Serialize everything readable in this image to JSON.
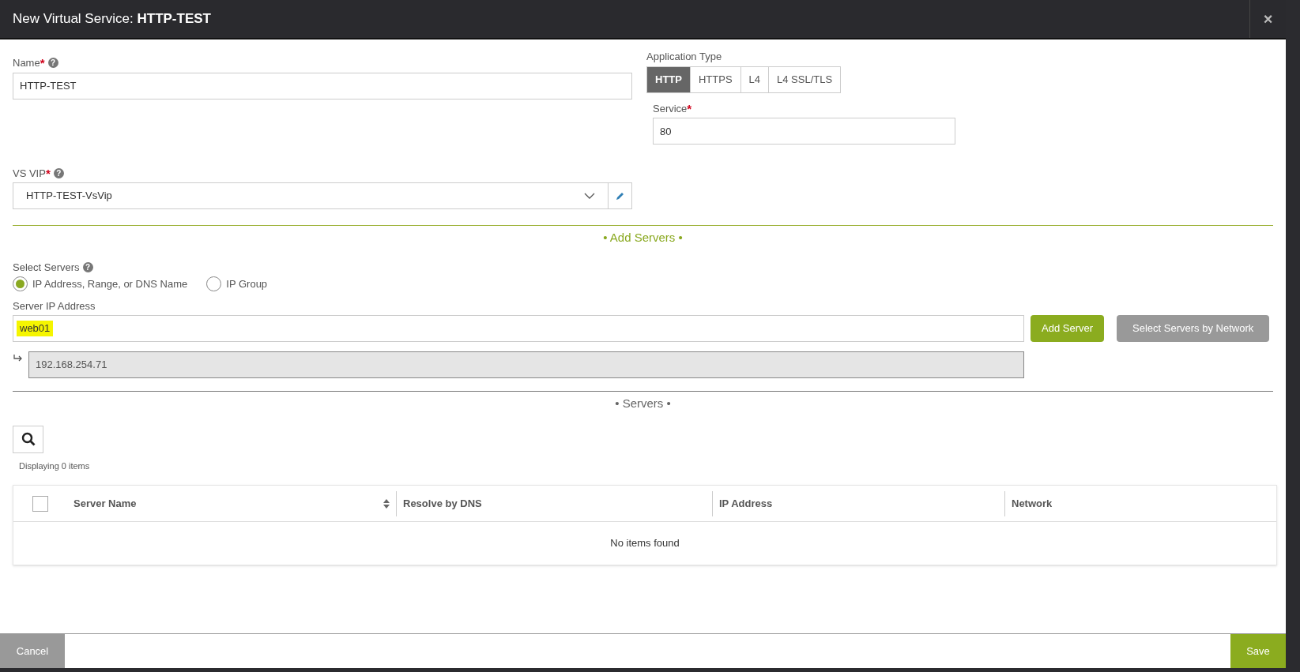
{
  "window": {
    "title_prefix": "New Virtual Service:",
    "title_name": "HTTP-TEST",
    "close": "×"
  },
  "name_field": {
    "label": "Name",
    "required": "*",
    "help": "?",
    "value": "HTTP-TEST"
  },
  "vs_vip": {
    "label": "VS VIP",
    "required": "*",
    "help": "?",
    "value": "HTTP-TEST-VsVip"
  },
  "application_type": {
    "label": "Application Type",
    "options": [
      {
        "label": "HTTP",
        "selected": true
      },
      {
        "label": "HTTPS",
        "selected": false
      },
      {
        "label": "L4",
        "selected": false
      },
      {
        "label": "L4 SSL/TLS",
        "selected": false
      }
    ]
  },
  "service": {
    "label": "Service",
    "required": "*",
    "value": "80"
  },
  "add_servers": {
    "heading": "• Add Servers •",
    "select_label": "Select Servers",
    "select_help": "?",
    "radios": [
      {
        "label": "IP Address, Range, or DNS Name",
        "selected": true
      },
      {
        "label": "IP Group",
        "selected": false
      }
    ],
    "ip_label": "Server IP Address",
    "ip_value": "web01",
    "highlighted": true,
    "resolved": "192.168.254.71",
    "buttons": [
      "Add Server",
      "Select Servers by Network"
    ]
  },
  "servers": {
    "heading": "• Servers •",
    "count": "Displaying 0 items",
    "select_all_checked": false,
    "columns": [
      "Server Name",
      "Resolve by DNS",
      "IP Address",
      "Network"
    ],
    "empty": "No items found"
  },
  "footer": {
    "cancel": "Cancel",
    "save": "Save"
  }
}
